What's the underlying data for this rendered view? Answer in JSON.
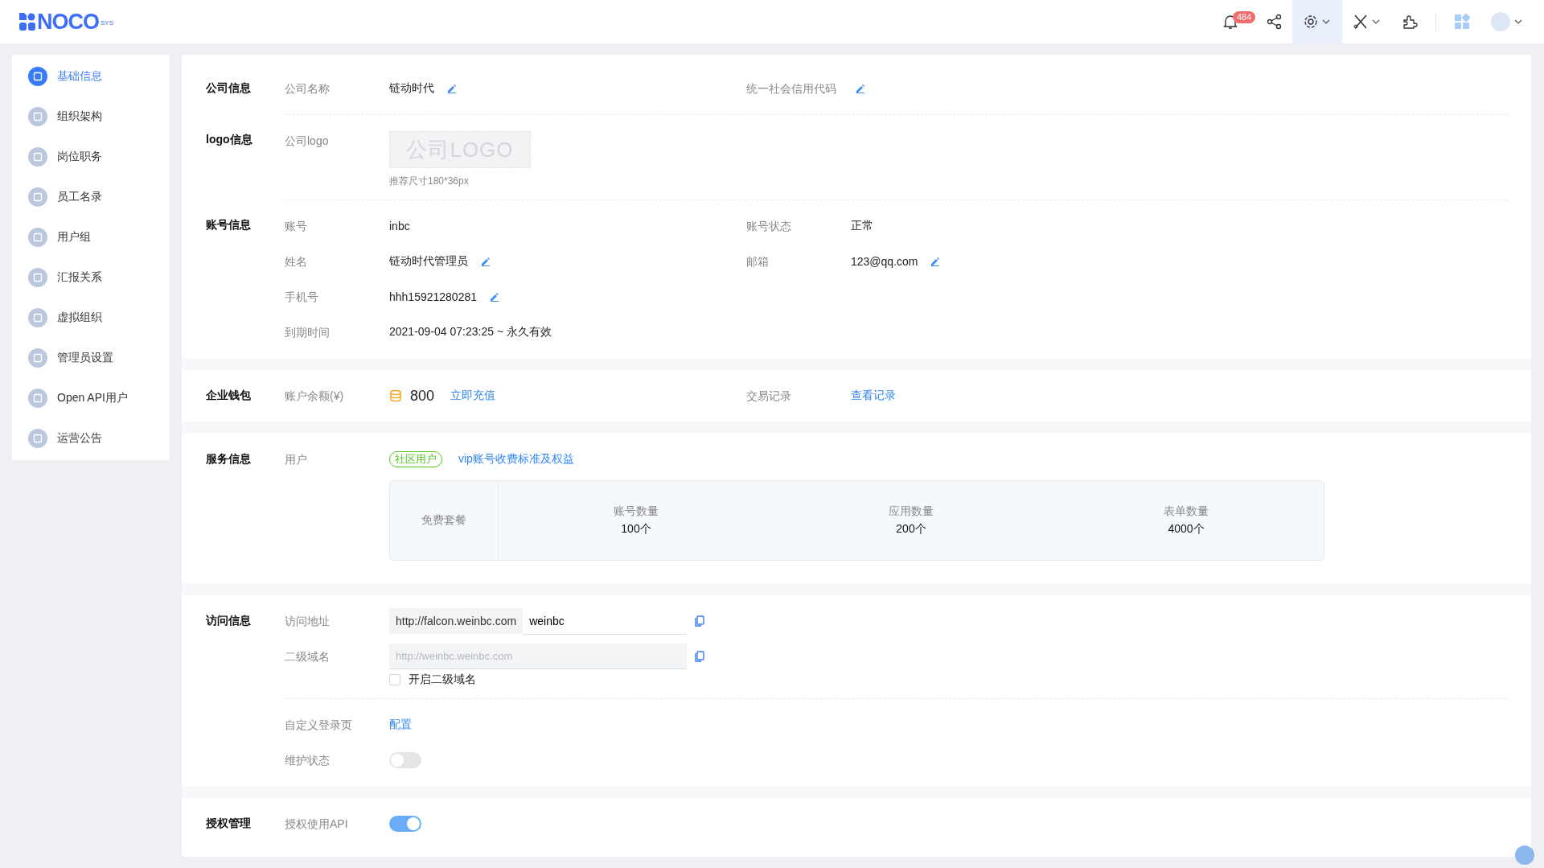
{
  "header": {
    "logo": {
      "text": "NOCO",
      "sup": "SYS"
    },
    "notification_count": "484"
  },
  "sidebar": {
    "items": [
      {
        "label": "基础信息",
        "selected": true
      },
      {
        "label": "组织架构",
        "selected": false
      },
      {
        "label": "岗位职务",
        "selected": false
      },
      {
        "label": "员工名录",
        "selected": false
      },
      {
        "label": "用户组",
        "selected": false
      },
      {
        "label": "汇报关系",
        "selected": false
      },
      {
        "label": "虚拟组织",
        "selected": false
      },
      {
        "label": "管理员设置",
        "selected": false
      },
      {
        "label": "Open API用户",
        "selected": false
      },
      {
        "label": "运营公告",
        "selected": false
      }
    ]
  },
  "sections": [
    {
      "title": "公司信息",
      "groups": [
        {
          "rows": [
            [
              {
                "label": "公司名称",
                "kind": "text",
                "value": "链动时代",
                "editable": true
              },
              {
                "label": "统一社会信用代码",
                "kind": "text",
                "editable": true
              }
            ]
          ]
        }
      ]
    },
    {
      "title": "logo信息",
      "groups": [
        {
          "rows": [
            [
              {
                "label": "公司logo",
                "kind": "logo",
                "placeholder": "公司LOGO",
                "hint": "推荐尺寸180*36px"
              }
            ]
          ]
        }
      ]
    },
    {
      "title": "账号信息",
      "groups": [
        {
          "rows": [
            [
              {
                "label": "账号",
                "kind": "text",
                "value": "inbc",
                "editable": false
              },
              {
                "label": "账号状态",
                "kind": "text",
                "value": "正常",
                "editable": false
              }
            ],
            [
              {
                "label": "姓名",
                "kind": "text",
                "value": "链动时代管理员",
                "editable": true
              },
              {
                "label": "邮箱",
                "kind": "text",
                "value": "123@qq.com",
                "editable": true
              }
            ],
            [
              {
                "label": "手机号",
                "kind": "text",
                "value": "hhh15921280281",
                "editable": true
              }
            ],
            [
              {
                "label": "到期时间",
                "kind": "text",
                "value": "2021-09-04 07:23:25 ~ 永久有效",
                "editable": false
              }
            ]
          ]
        }
      ]
    },
    {
      "title": "企业钱包",
      "groups": [
        {
          "rows": [
            [
              {
                "label": "账户余额(¥)",
                "kind": "wallet",
                "amount": "800",
                "link": "立即充值"
              },
              {
                "label": "交易记录",
                "kind": "link",
                "value": "查看记录"
              }
            ]
          ]
        }
      ]
    },
    {
      "title": "服务信息",
      "groups": [
        {
          "rows": [
            [
              {
                "label": "用户",
                "kind": "service",
                "tag": "社区用户",
                "link": "vip账号收费标准及权益",
                "plan": {
                  "name": "免费套餐",
                  "items": [
                    {
                      "label": "账号数量",
                      "value": "100个"
                    },
                    {
                      "label": "应用数量",
                      "value": "200个"
                    },
                    {
                      "label": "表单数量",
                      "value": "4000个"
                    }
                  ]
                }
              }
            ]
          ]
        }
      ]
    },
    {
      "title": "访问信息",
      "groups": [
        {
          "rows": [
            [
              {
                "label": "访问地址",
                "kind": "url",
                "prefix": "http://falcon.weinbc.com",
                "value": "weinbc"
              }
            ],
            [
              {
                "label": "二级域名",
                "kind": "domain",
                "placeholder": "http://weinbc.weinbc.com",
                "checkbox": {
                  "label": "开启二级域名",
                  "checked": false
                }
              }
            ]
          ]
        },
        {
          "rows": [
            [
              {
                "label": "自定义登录页",
                "kind": "link",
                "value": "配置"
              }
            ],
            [
              {
                "label": "维护状态",
                "kind": "toggle",
                "on": false
              }
            ]
          ]
        }
      ]
    },
    {
      "title": "授权管理",
      "groups": [
        {
          "rows": [
            [
              {
                "label": "授权使用API",
                "kind": "toggle",
                "on": true
              }
            ]
          ]
        }
      ]
    }
  ]
}
